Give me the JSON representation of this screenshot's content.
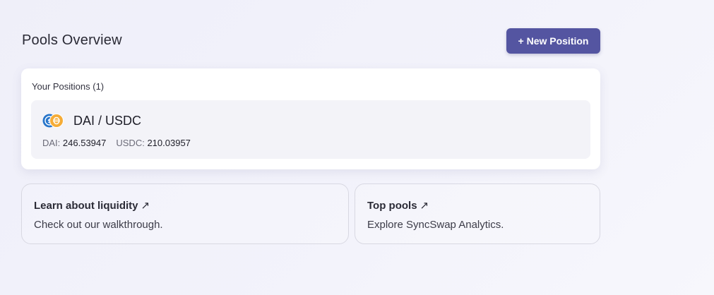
{
  "page": {
    "title": "Pools Overview",
    "new_position_label": "+ New Position"
  },
  "positions": {
    "heading": "Your Positions (1)",
    "items": [
      {
        "pair": "DAI / USDC",
        "icons": [
          "usdc-icon",
          "dai-icon"
        ],
        "amounts": [
          {
            "label": "DAI:",
            "value": "246.53947"
          },
          {
            "label": "USDC:",
            "value": "210.03957"
          }
        ]
      }
    ]
  },
  "cards": [
    {
      "title": "Learn about liquidity",
      "arrow": "↗",
      "description": "Check out our walkthrough."
    },
    {
      "title": "Top pools",
      "arrow": "↗",
      "description": "Explore SyncSwap Analytics."
    }
  ],
  "colors": {
    "accent": "#5455a1",
    "usdc": "#2775ca",
    "dai": "#f5ac37"
  }
}
